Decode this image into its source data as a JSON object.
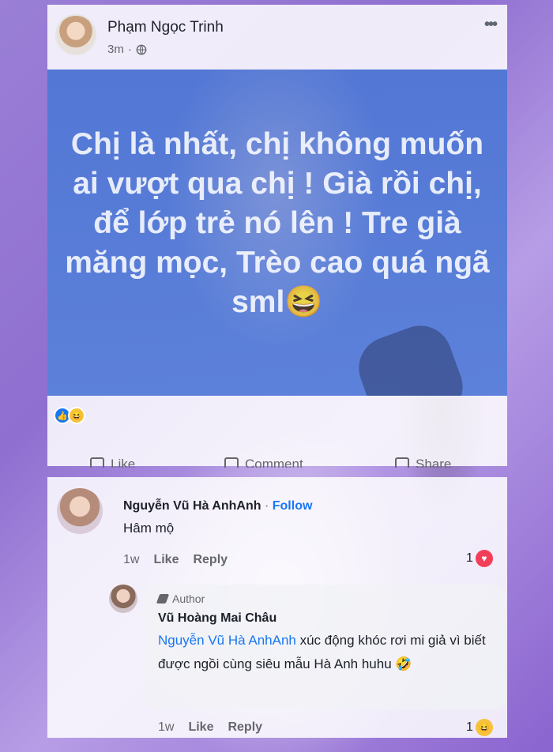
{
  "post": {
    "author": "Phạm Ngọc Trinh",
    "time": "3m",
    "privacy_icon": "globe-icon",
    "more_icon": "more-options-icon",
    "text": "Chị là nhất, chị không muốn ai vượt qua chị ! Già rồi chị, để lớp trẻ nó lên ! Tre già măng mọc, Trèo cao quá ngã sml😆",
    "reactions": [
      "like",
      "haha"
    ],
    "actions": {
      "like": "Like",
      "comment": "Comment",
      "share": "Share"
    }
  },
  "comments": [
    {
      "name": "Nguyễn Vũ Hà AnhAnh",
      "separator": "·",
      "follow": "Follow",
      "text": "Hâm mộ",
      "time": "1w",
      "like": "Like",
      "reply": "Reply",
      "reaction_count": "1",
      "reaction": "love"
    }
  ],
  "reply": {
    "badge": "Author",
    "name": "Vũ Hoàng Mai Châu",
    "mention": "Nguyễn Vũ Hà AnhAnh",
    "text": "xúc động khóc rơi mi giả vì biết được ngồi cùng siêu mẫu Hà Anh huhu 🤣",
    "time": "1w",
    "like": "Like",
    "reply": "Reply",
    "reaction_count": "1",
    "reaction": "haha"
  },
  "colors": {
    "accent": "#1877f2",
    "post_image_bg": "#4f78d4",
    "love": "#f33e58",
    "haha": "#f7c23b"
  }
}
